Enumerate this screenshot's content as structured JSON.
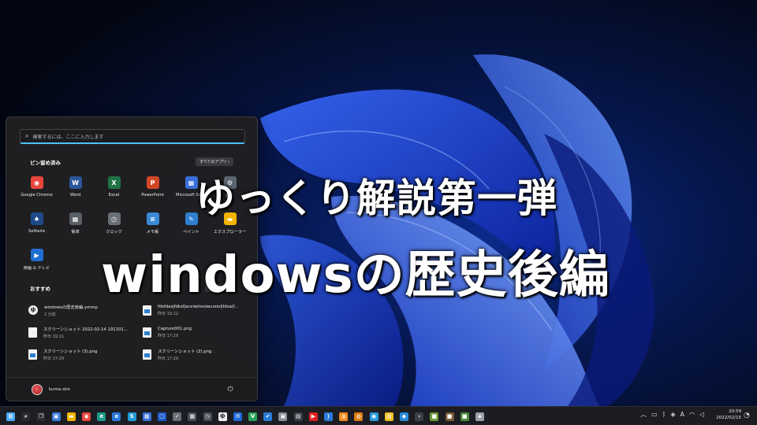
{
  "overlay": {
    "title_line1": "ゆっくり解説第一弾",
    "title_line2": "windowsの歴史後編"
  },
  "start_menu": {
    "search_placeholder": "検索するには、ここに入力します",
    "pinned_title": "ピン留め済み",
    "all_apps_label": "すべてのアプリ ›",
    "pinned_apps": [
      {
        "label": "Google Chrome",
        "icon": "chrome-icon",
        "color": "#e8453c",
        "glyph": "◉"
      },
      {
        "label": "Word",
        "icon": "word-icon",
        "color": "#2b579a",
        "glyph": "W"
      },
      {
        "label": "Excel",
        "icon": "excel-icon",
        "color": "#217346",
        "glyph": "X"
      },
      {
        "label": "PowerPoint",
        "icon": "powerpoint-icon",
        "color": "#d24726",
        "glyph": "P"
      },
      {
        "label": "Microsoft Store",
        "icon": "store-icon",
        "color": "#3a6fd8",
        "glyph": "▦"
      },
      {
        "label": "設定",
        "icon": "settings-icon",
        "color": "#5a6570",
        "glyph": "⚙"
      },
      {
        "label": "Solitaire",
        "icon": "solitaire-icon",
        "color": "#1e4a8a",
        "glyph": "♠"
      },
      {
        "label": "電卓",
        "icon": "calculator-icon",
        "color": "#5b5f66",
        "glyph": "▦"
      },
      {
        "label": "クロック",
        "icon": "clock-icon",
        "color": "#6b6f76",
        "glyph": "◷"
      },
      {
        "label": "メモ帳",
        "icon": "notepad-icon",
        "color": "#3a8ad8",
        "glyph": "≡"
      },
      {
        "label": "ペイント",
        "icon": "paint-icon",
        "color": "#2f7fd0",
        "glyph": "✎"
      },
      {
        "label": "エクスプローラー",
        "icon": "folder-icon",
        "color": "#f0b400",
        "glyph": "▬"
      },
      {
        "label": "映画 & テレビ",
        "icon": "movies-tv-icon",
        "color": "#1f6fd0",
        "glyph": "▶"
      }
    ],
    "recommended_title": "おすすめ",
    "more_label": "その他 ›",
    "recommended": [
      {
        "name": "windowsの歴史後編.ymmp",
        "time": "2 分前",
        "icon": "ymmp-file-icon"
      },
      {
        "name": "fdsfdasjfdksfjaceiwireoiwureioljfdsa(f...",
        "time": "昨日 19:12",
        "icon": "image-file-icon"
      },
      {
        "name": "スクリーンショット 2022-02-14 191101...",
        "time": "昨日 19:11",
        "icon": "blank-file-icon"
      },
      {
        "name": "Capture001.png",
        "time": "昨日 17:29",
        "icon": "image-file-icon"
      },
      {
        "name": "スクリーンショット (3).png",
        "time": "昨日 17:29",
        "icon": "image-file-icon"
      },
      {
        "name": "スクリーンショット (2).png",
        "time": "昨日 17:29",
        "icon": "image-file-icon"
      }
    ],
    "user_name": "kuma siro"
  },
  "taskbar": {
    "icons": [
      {
        "name": "start-icon",
        "color": "#4aa8ff",
        "glyph": "⊞"
      },
      {
        "name": "search-icon",
        "color": "#2a2b30",
        "glyph": "⌕"
      },
      {
        "name": "task-view-icon",
        "color": "#2a2b30",
        "glyph": "❐"
      },
      {
        "name": "widgets-icon",
        "color": "#3a7ad8",
        "glyph": "▣"
      },
      {
        "name": "explorer-icon",
        "color": "#f0b400",
        "glyph": "▬"
      },
      {
        "name": "chrome-icon",
        "color": "#e8453c",
        "glyph": "◉"
      },
      {
        "name": "edge-icon",
        "color": "#1a9a8a",
        "glyph": "e"
      },
      {
        "name": "edge-dev-icon",
        "color": "#2a7ad8",
        "glyph": "e"
      },
      {
        "name": "skype-icon",
        "color": "#1e9ad8",
        "glyph": "S"
      },
      {
        "name": "photos-icon",
        "color": "#3a6fd8",
        "glyph": "▦"
      },
      {
        "name": "window-icon",
        "color": "#1e5ac8",
        "glyph": "▢"
      },
      {
        "name": "check-app-icon",
        "color": "#6b6f76",
        "glyph": "✓"
      },
      {
        "name": "calculator-icon",
        "color": "#4a4e56",
        "glyph": "▦"
      },
      {
        "name": "clock-icon",
        "color": "#4a4e56",
        "glyph": "◷"
      },
      {
        "name": "yukkuri-movie-maker-icon",
        "color": "#f0f0f0",
        "glyph": "ゆ"
      },
      {
        "name": "mail-icon",
        "color": "#1e6ad8",
        "glyph": "✉"
      },
      {
        "name": "vim-icon",
        "color": "#2aa05a",
        "glyph": "V"
      },
      {
        "name": "todo-icon",
        "color": "#2a7ad8",
        "glyph": "✔"
      },
      {
        "name": "box-icon",
        "color": "#8a8e96",
        "glyph": "▣"
      },
      {
        "name": "film-icon",
        "color": "#3a3e46",
        "glyph": "▤"
      },
      {
        "name": "youtube-icon",
        "color": "#e02020",
        "glyph": "▶"
      },
      {
        "name": "vscode-icon",
        "color": "#2a7ad8",
        "glyph": "⟩"
      },
      {
        "name": "blender-icon",
        "color": "#f08a1e",
        "glyph": "◍"
      },
      {
        "name": "blender-alt-icon",
        "color": "#e07a10",
        "glyph": "◍"
      },
      {
        "name": "maps-icon",
        "color": "#2a9ad8",
        "glyph": "◉"
      },
      {
        "name": "sticky-notes-icon",
        "color": "#f0c020",
        "glyph": "▤"
      },
      {
        "name": "paint3d-icon",
        "color": "#2a8ad8",
        "glyph": "◆"
      },
      {
        "name": "terminal-icon",
        "color": "#3a3e46",
        "glyph": "›"
      },
      {
        "name": "minecraft-icon",
        "color": "#6a9a3a",
        "glyph": "■"
      },
      {
        "name": "minecraft-dungeons-icon",
        "color": "#7a5a3a",
        "glyph": "■"
      },
      {
        "name": "minecraft-edu-icon",
        "color": "#4a8a3a",
        "glyph": "■"
      },
      {
        "name": "shield-icon",
        "color": "#9aa0a8",
        "glyph": "◈"
      }
    ],
    "tray_ime": "A",
    "time": "20:59",
    "date": "2022/02/15"
  }
}
